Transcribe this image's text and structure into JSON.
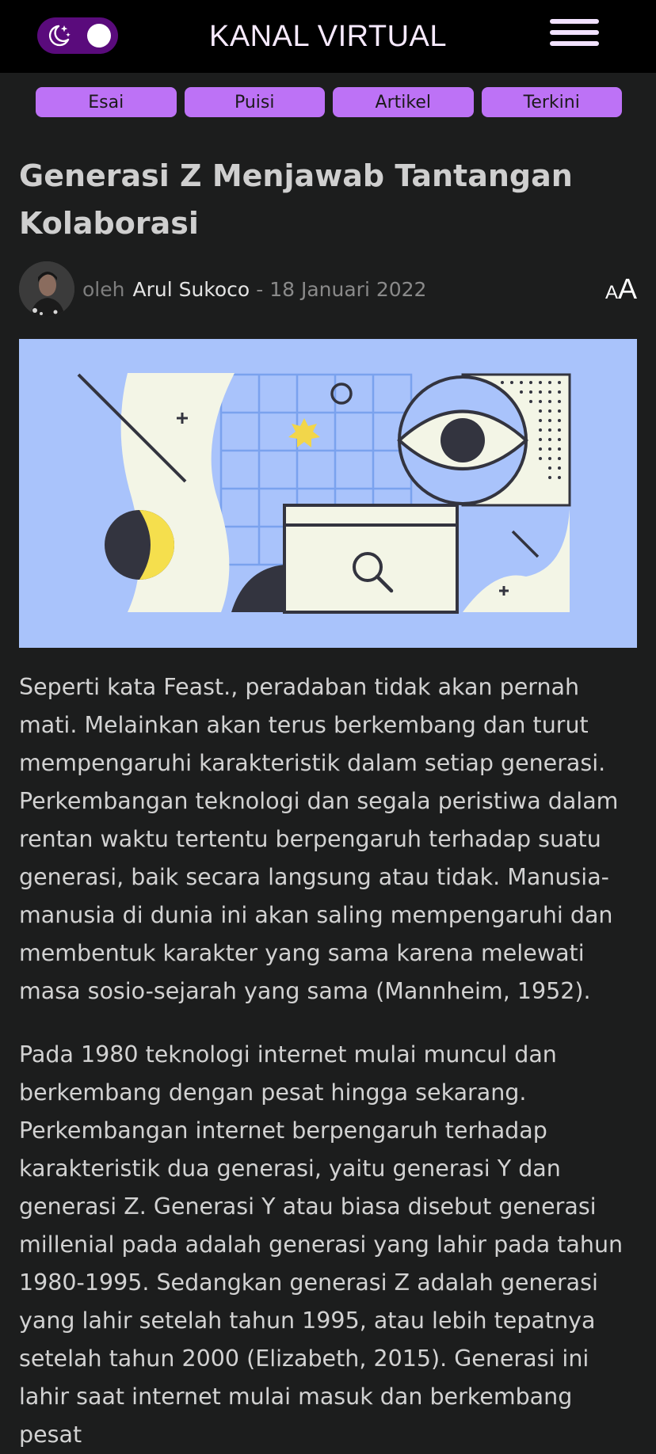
{
  "header": {
    "site_title": "KANAL VIRTUAL",
    "theme_toggle_icon": "moon-stars-icon",
    "menu_icon": "hamburger-menu-icon"
  },
  "categories": [
    {
      "label": "Esai"
    },
    {
      "label": "Puisi"
    },
    {
      "label": "Artikel"
    },
    {
      "label": "Terkini"
    }
  ],
  "article": {
    "title": "Generasi Z Menjawab Tantangan Kolaborasi",
    "by_label": "oleh",
    "author": "Arul Sukoco",
    "date": "- 18 Januari 2022",
    "font_size_small": "A",
    "font_size_large": "A",
    "paragraphs": [
      "Seperti kata Feast., peradaban tidak akan pernah mati. Melainkan akan terus berkembang dan turut mempengaruhi karakteristik dalam setiap generasi. Perkembangan teknologi dan segala peristiwa dalam rentan waktu tertentu berpengaruh terhadap suatu generasi, baik secara langsung atau tidak. Manusia-manusia di dunia ini akan saling mempengaruhi dan membentuk karakter yang sama karena melewati masa sosio-sejarah yang sama (Mannheim, 1952).",
      "Pada 1980 teknologi internet mulai muncul dan berkembang dengan pesat hingga sekarang. Perkembangan internet berpengaruh terhadap karakteristik dua generasi, yaitu generasi Y dan generasi Z. Generasi Y atau biasa disebut generasi millenial pada adalah generasi yang lahir pada tahun 1980-1995. Sedangkan generasi Z adalah generasi yang lahir setelah tahun 1995, atau lebih tepatnya setelah tahun 2000 (Elizabeth, 2015). Generasi ini lahir saat internet mulai masuk dan berkembang pesat"
    ]
  },
  "colors": {
    "topbar": "#000000",
    "background": "#1c1d1d",
    "category_pill": "#bd72f6",
    "toggle": "#5a0b7c",
    "hero_background": "#a9c3fb"
  }
}
